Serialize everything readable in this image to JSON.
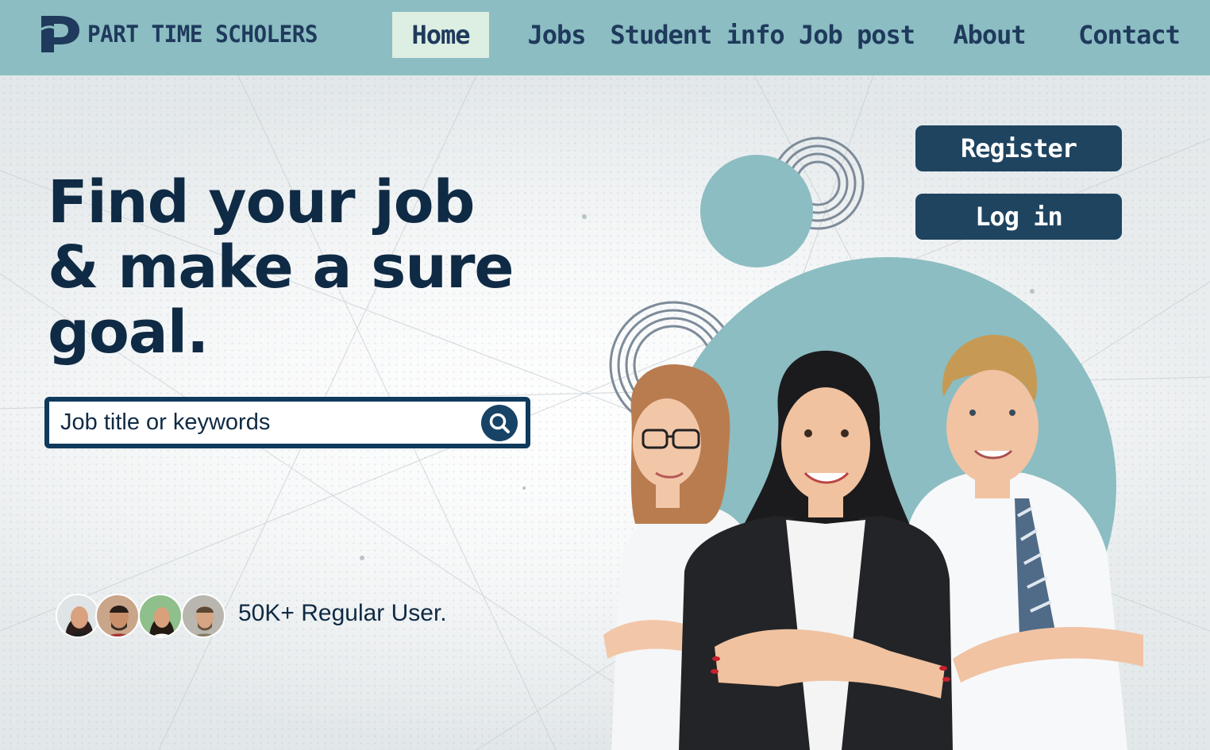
{
  "brand": {
    "name": "PART TIME SCHOLERS",
    "logo_icon": "p-letter-logo-icon"
  },
  "nav": {
    "items": [
      {
        "label": "Home",
        "active": true
      },
      {
        "label": "Jobs",
        "active": false
      },
      {
        "label": "Student info",
        "active": false
      },
      {
        "label": "Job post",
        "active": false
      },
      {
        "label": "About",
        "active": false
      },
      {
        "label": "Contact",
        "active": false
      }
    ]
  },
  "hero": {
    "headline_lines": [
      "Find your job",
      "& make a sure",
      "goal."
    ],
    "search": {
      "placeholder": "Job title or keywords",
      "value": "",
      "icon": "search-icon"
    },
    "users": {
      "avatar_count": 4,
      "text": "50K+ Regular User."
    }
  },
  "auth": {
    "register_label": "Register",
    "login_label": "Log in"
  },
  "colors": {
    "nav_bg": "#8bbdc2",
    "active_tab_bg": "#ddeee2",
    "brand_navy": "#1f3a5c",
    "headline": "#0f2a44",
    "button_bg": "#1f4460",
    "accent_teal": "#8bbdc2",
    "ring_grey": "#7d8b99"
  }
}
